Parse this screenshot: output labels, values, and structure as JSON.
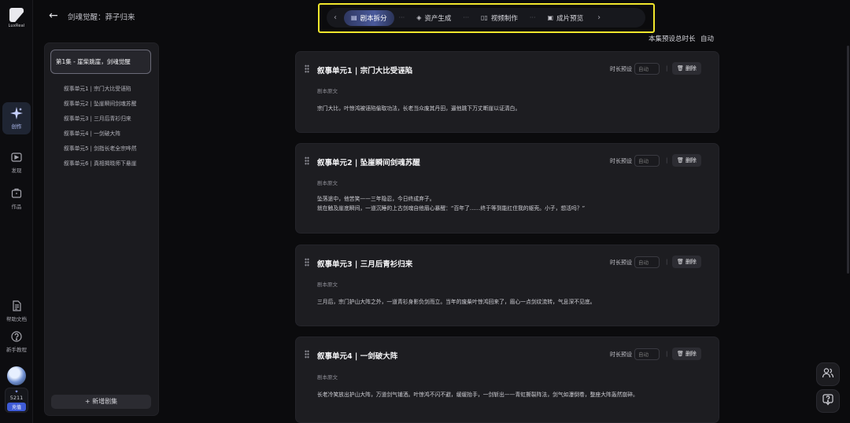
{
  "rail": {
    "logo_text": "LuxReal",
    "items": [
      {
        "icon": "sparkle-icon",
        "label": "创作"
      },
      {
        "icon": "discover-icon",
        "label": "发现"
      },
      {
        "icon": "works-icon",
        "label": "作品"
      },
      {
        "icon": "document-icon",
        "label": "帮助文档"
      },
      {
        "icon": "question-icon",
        "label": "新手教程"
      }
    ],
    "credits": "5211",
    "recharge_label": "充值"
  },
  "header": {
    "title": "剑魂觉醒：莽子归来"
  },
  "stepnav": {
    "steps": [
      {
        "icon": "script-icon",
        "label": "剧本拆分"
      },
      {
        "icon": "cube-icon",
        "label": "资产生成"
      },
      {
        "icon": "video-icon",
        "label": "视频制作"
      },
      {
        "icon": "preview-icon",
        "label": "成片预览"
      }
    ],
    "active_index": 0
  },
  "total_duration": {
    "label": "本集预设总时长",
    "value": "自动"
  },
  "episode_panel": {
    "current_episode": "第1集 - 崖柴跳崖，剑魂觉醒",
    "units": [
      "叙事单元1 | 宗门大比受诬陷",
      "叙事单元2 | 坠崖瞬间剑魂苏醒",
      "叙事单元3 | 三月后青衫归来",
      "叙事单元4 | 一剑破大阵",
      "叙事单元5 | 剑指长老全宗哗然",
      "叙事单元6 | 真相揭晓师下悬崖"
    ],
    "add_label": "+ 新增剧集"
  },
  "cards": [
    {
      "title": "叙事单元1 | 宗门大比受诬陷",
      "duration_label": "时长预设",
      "duration_placeholder": "自动",
      "delete_label": "删除",
      "source_label": "剧本原文",
      "body": "宗门大比，叶惊鸿被诬陷偷取功法，长老当众废其丹田，逼他跳下万丈断崖以证清白。"
    },
    {
      "title": "叙事单元2 | 坠崖瞬间剑魂苏醒",
      "duration_label": "时长预设",
      "duration_placeholder": "自动",
      "delete_label": "删除",
      "source_label": "剧本原文",
      "body": "坠落途中，他苦笑——三年隐忍，今日终成弃子。\n就在触及崖底瞬间，一道沉睡的上古剑魂自他眉心暴醒：“百年了……终于等到能扛住我的躯壳。小子，想活吗？”"
    },
    {
      "title": "叙事单元3 | 三月后青衫归来",
      "duration_label": "时长预设",
      "duration_placeholder": "自动",
      "delete_label": "删除",
      "source_label": "剧本原文",
      "body": "三月后，宗门护山大阵之外，一道青衫身影负剑而立。当年的废柴叶惊鸿回来了，眉心一点剑纹流转，气息深不见底。"
    },
    {
      "title": "叙事单元4 | 一剑破大阵",
      "duration_label": "时长预设",
      "duration_placeholder": "自动",
      "delete_label": "删除",
      "source_label": "剧本原文",
      "body": "长老冷笑放出护山大阵，万道剑气铺洒。叶惊鸿不闪不避，缓缓抬手，一剑斩出——青虹撕裂阵法，剑气如瀑倒卷，整座大阵轰然崩碎。"
    }
  ]
}
